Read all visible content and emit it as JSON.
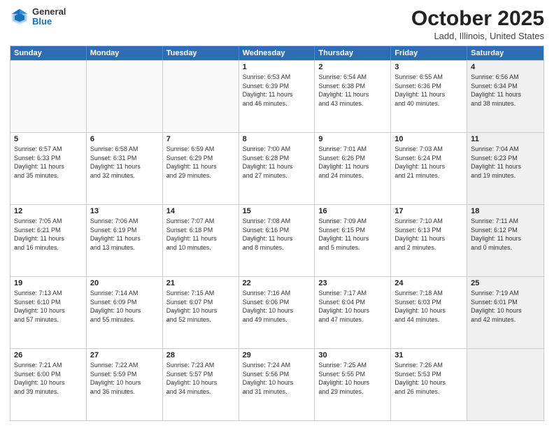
{
  "header": {
    "logo": {
      "general": "General",
      "blue": "Blue"
    },
    "title": "October 2025",
    "location": "Ladd, Illinois, United States"
  },
  "weekdays": [
    "Sunday",
    "Monday",
    "Tuesday",
    "Wednesday",
    "Thursday",
    "Friday",
    "Saturday"
  ],
  "rows": [
    {
      "cells": [
        {
          "day": "",
          "empty": true
        },
        {
          "day": "",
          "empty": true
        },
        {
          "day": "",
          "empty": true
        },
        {
          "day": "1",
          "info": "Sunrise: 6:53 AM\nSunset: 6:39 PM\nDaylight: 11 hours\nand 46 minutes."
        },
        {
          "day": "2",
          "info": "Sunrise: 6:54 AM\nSunset: 6:38 PM\nDaylight: 11 hours\nand 43 minutes."
        },
        {
          "day": "3",
          "info": "Sunrise: 6:55 AM\nSunset: 6:36 PM\nDaylight: 11 hours\nand 40 minutes."
        },
        {
          "day": "4",
          "info": "Sunrise: 6:56 AM\nSunset: 6:34 PM\nDaylight: 11 hours\nand 38 minutes.",
          "shaded": true
        }
      ]
    },
    {
      "cells": [
        {
          "day": "5",
          "info": "Sunrise: 6:57 AM\nSunset: 6:33 PM\nDaylight: 11 hours\nand 35 minutes."
        },
        {
          "day": "6",
          "info": "Sunrise: 6:58 AM\nSunset: 6:31 PM\nDaylight: 11 hours\nand 32 minutes."
        },
        {
          "day": "7",
          "info": "Sunrise: 6:59 AM\nSunset: 6:29 PM\nDaylight: 11 hours\nand 29 minutes."
        },
        {
          "day": "8",
          "info": "Sunrise: 7:00 AM\nSunset: 6:28 PM\nDaylight: 11 hours\nand 27 minutes."
        },
        {
          "day": "9",
          "info": "Sunrise: 7:01 AM\nSunset: 6:26 PM\nDaylight: 11 hours\nand 24 minutes."
        },
        {
          "day": "10",
          "info": "Sunrise: 7:03 AM\nSunset: 6:24 PM\nDaylight: 11 hours\nand 21 minutes."
        },
        {
          "day": "11",
          "info": "Sunrise: 7:04 AM\nSunset: 6:23 PM\nDaylight: 11 hours\nand 19 minutes.",
          "shaded": true
        }
      ]
    },
    {
      "cells": [
        {
          "day": "12",
          "info": "Sunrise: 7:05 AM\nSunset: 6:21 PM\nDaylight: 11 hours\nand 16 minutes."
        },
        {
          "day": "13",
          "info": "Sunrise: 7:06 AM\nSunset: 6:19 PM\nDaylight: 11 hours\nand 13 minutes."
        },
        {
          "day": "14",
          "info": "Sunrise: 7:07 AM\nSunset: 6:18 PM\nDaylight: 11 hours\nand 10 minutes."
        },
        {
          "day": "15",
          "info": "Sunrise: 7:08 AM\nSunset: 6:16 PM\nDaylight: 11 hours\nand 8 minutes."
        },
        {
          "day": "16",
          "info": "Sunrise: 7:09 AM\nSunset: 6:15 PM\nDaylight: 11 hours\nand 5 minutes."
        },
        {
          "day": "17",
          "info": "Sunrise: 7:10 AM\nSunset: 6:13 PM\nDaylight: 11 hours\nand 2 minutes."
        },
        {
          "day": "18",
          "info": "Sunrise: 7:11 AM\nSunset: 6:12 PM\nDaylight: 11 hours\nand 0 minutes.",
          "shaded": true
        }
      ]
    },
    {
      "cells": [
        {
          "day": "19",
          "info": "Sunrise: 7:13 AM\nSunset: 6:10 PM\nDaylight: 10 hours\nand 57 minutes."
        },
        {
          "day": "20",
          "info": "Sunrise: 7:14 AM\nSunset: 6:09 PM\nDaylight: 10 hours\nand 55 minutes."
        },
        {
          "day": "21",
          "info": "Sunrise: 7:15 AM\nSunset: 6:07 PM\nDaylight: 10 hours\nand 52 minutes."
        },
        {
          "day": "22",
          "info": "Sunrise: 7:16 AM\nSunset: 6:06 PM\nDaylight: 10 hours\nand 49 minutes."
        },
        {
          "day": "23",
          "info": "Sunrise: 7:17 AM\nSunset: 6:04 PM\nDaylight: 10 hours\nand 47 minutes."
        },
        {
          "day": "24",
          "info": "Sunrise: 7:18 AM\nSunset: 6:03 PM\nDaylight: 10 hours\nand 44 minutes."
        },
        {
          "day": "25",
          "info": "Sunrise: 7:19 AM\nSunset: 6:01 PM\nDaylight: 10 hours\nand 42 minutes.",
          "shaded": true
        }
      ]
    },
    {
      "cells": [
        {
          "day": "26",
          "info": "Sunrise: 7:21 AM\nSunset: 6:00 PM\nDaylight: 10 hours\nand 39 minutes."
        },
        {
          "day": "27",
          "info": "Sunrise: 7:22 AM\nSunset: 5:59 PM\nDaylight: 10 hours\nand 36 minutes."
        },
        {
          "day": "28",
          "info": "Sunrise: 7:23 AM\nSunset: 5:57 PM\nDaylight: 10 hours\nand 34 minutes."
        },
        {
          "day": "29",
          "info": "Sunrise: 7:24 AM\nSunset: 5:56 PM\nDaylight: 10 hours\nand 31 minutes."
        },
        {
          "day": "30",
          "info": "Sunrise: 7:25 AM\nSunset: 5:55 PM\nDaylight: 10 hours\nand 29 minutes."
        },
        {
          "day": "31",
          "info": "Sunrise: 7:26 AM\nSunset: 5:53 PM\nDaylight: 10 hours\nand 26 minutes."
        },
        {
          "day": "",
          "empty": true,
          "shaded": true
        }
      ]
    }
  ]
}
